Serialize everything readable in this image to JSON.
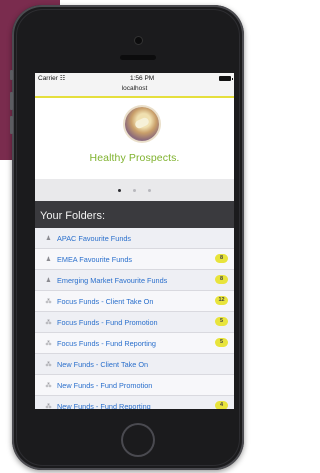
{
  "status": {
    "carrier": "Carrier",
    "time": "1:56 PM",
    "wifi_icon": "wifi-icon",
    "battery_icon": "battery-icon"
  },
  "browser": {
    "address": "localhost"
  },
  "brand": {
    "name": "Healthy Prospects."
  },
  "carousel": {
    "dots": 3,
    "active": 0
  },
  "folders": {
    "title": "Your Folders:",
    "items": [
      {
        "label": "APAC Favourite Funds",
        "icon": "person-icon",
        "badge": ""
      },
      {
        "label": "EMEA Favourite Funds",
        "icon": "person-icon",
        "badge": "8"
      },
      {
        "label": "Emerging Market Favourite Funds",
        "icon": "person-icon",
        "badge": "8"
      },
      {
        "label": "Focus Funds - Client Take On",
        "icon": "share-icon",
        "badge": "12"
      },
      {
        "label": "Focus Funds - Fund Promotion",
        "icon": "share-icon",
        "badge": "5"
      },
      {
        "label": "Focus Funds - Fund Reporting",
        "icon": "share-icon",
        "badge": "5"
      },
      {
        "label": "New Funds - Client Take On",
        "icon": "share-icon",
        "badge": ""
      },
      {
        "label": "New Funds - Fund Promotion",
        "icon": "share-icon",
        "badge": ""
      },
      {
        "label": "New Funds - Fund Reporting",
        "icon": "share-icon",
        "badge": "4"
      }
    ]
  },
  "colors": {
    "accent": "#e5df3d",
    "brand": "#7fb22e",
    "link": "#2a6fcc",
    "header": "#3a3a3e"
  }
}
